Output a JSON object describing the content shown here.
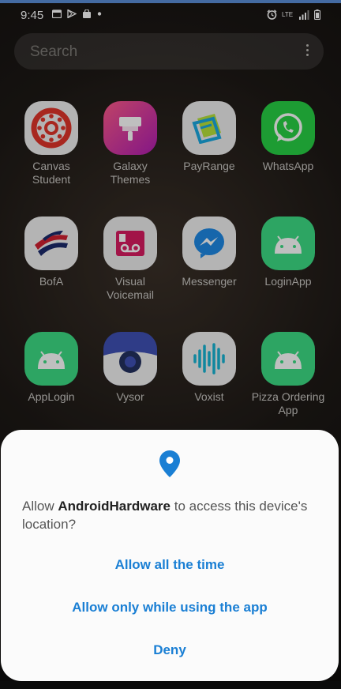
{
  "status_bar": {
    "time": "9:45",
    "left_icons": [
      "calendar-icon",
      "play-store-icon",
      "bag-icon",
      "dot-icon"
    ],
    "right_icons": [
      "alarm-icon",
      "lte-icon",
      "signal-icon",
      "battery-icon"
    ],
    "network_label": "LTE"
  },
  "search": {
    "placeholder": "Search"
  },
  "apps": [
    {
      "label": "Canvas\nStudent",
      "icon": "canvas-icon",
      "color": "#e1342a"
    },
    {
      "label": "Galaxy\nThemes",
      "icon": "galaxy-themes-icon",
      "color": "#c5239a"
    },
    {
      "label": "PayRange",
      "icon": "payrange-icon",
      "color": "#1aa8e0"
    },
    {
      "label": "WhatsApp",
      "icon": "whatsapp-icon",
      "color": "#27d045"
    },
    {
      "label": "BofA",
      "icon": "bofa-icon",
      "color": "#d02030"
    },
    {
      "label": "Visual\nVoicemail",
      "icon": "visual-voicemail-icon",
      "color": "#d81b60"
    },
    {
      "label": "Messenger",
      "icon": "messenger-icon",
      "color": "#1e88e5"
    },
    {
      "label": "LoginApp",
      "icon": "android-icon",
      "color": "#3ddc84"
    },
    {
      "label": "AppLogin",
      "icon": "android-icon",
      "color": "#3ddc84"
    },
    {
      "label": "Vysor",
      "icon": "vysor-icon",
      "color": "#3f51b5"
    },
    {
      "label": "Voxist",
      "icon": "voxist-icon",
      "color": "#16b5d4"
    },
    {
      "label": "Pizza Ordering\nApp",
      "icon": "android-icon",
      "color": "#3ddc84"
    }
  ],
  "dialog": {
    "icon": "location-pin-icon",
    "accent_color": "#1a7fd4",
    "message_prefix": "Allow ",
    "app_name": "AndroidHardware",
    "message_suffix": " to access this device's location?",
    "buttons": {
      "allow_all": "Allow all the time",
      "allow_while_using": "Allow only while using the app",
      "deny": "Deny"
    }
  }
}
